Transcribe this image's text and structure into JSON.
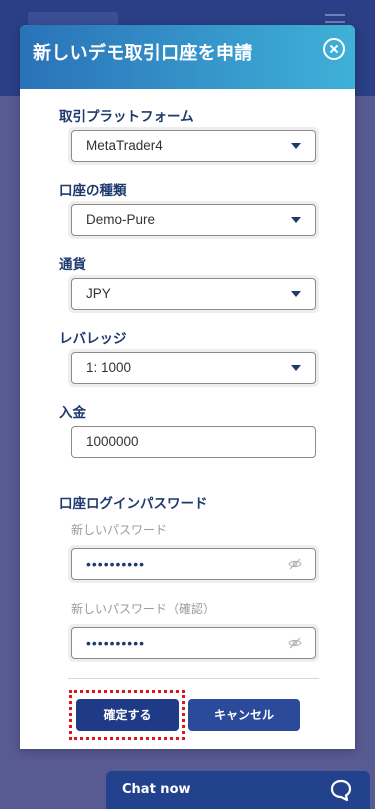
{
  "modal": {
    "title": "新しいデモ取引口座を申請"
  },
  "fields": {
    "platform_label": "取引プラットフォーム",
    "platform_value": "MetaTrader4",
    "account_type_label": "口座の種類",
    "account_type_value": "Demo-Pure",
    "currency_label": "通貨",
    "currency_value": "JPY",
    "leverage_label": "レバレッジ",
    "leverage_value": "1: 1000",
    "deposit_label": "入金",
    "deposit_value": "1000000",
    "password_section_label": "口座ログインパスワード",
    "new_password_label": "新しいパスワード",
    "new_password_value": "••••••••••",
    "confirm_password_label": "新しいパスワード（確認）",
    "confirm_password_value": "••••••••••"
  },
  "buttons": {
    "confirm_label": "確定する",
    "cancel_label": "キャンセル"
  },
  "chat": {
    "label": "Chat now"
  },
  "colors": {
    "header_start": "#2a72b8",
    "header_end": "#3fb1d8",
    "primary": "#1f3a86",
    "label": "#1f3a6e",
    "focus_ring": "#e0141e"
  }
}
